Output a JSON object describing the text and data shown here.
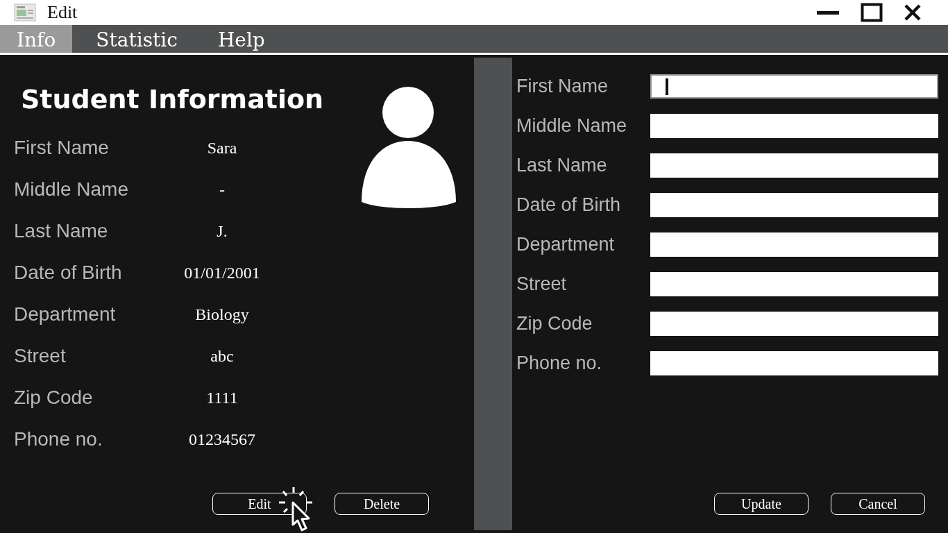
{
  "window": {
    "title": "Edit"
  },
  "tabs": [
    {
      "label": "Info",
      "selected": true
    },
    {
      "label": "Statistic",
      "selected": false
    },
    {
      "label": "Help",
      "selected": false
    }
  ],
  "student": {
    "heading": "Student Information",
    "fields": [
      {
        "label": "First Name",
        "value": "Sara"
      },
      {
        "label": "Middle Name",
        "value": "-"
      },
      {
        "label": "Last Name",
        "value": "J."
      },
      {
        "label": "Date of Birth",
        "value": "01/01/2001"
      },
      {
        "label": "Department",
        "value": "Biology"
      },
      {
        "label": "Street",
        "value": "abc"
      },
      {
        "label": "Zip Code",
        "value": "1111"
      },
      {
        "label": "Phone no.",
        "value": "01234567"
      }
    ],
    "buttons": [
      "Edit",
      "Delete"
    ]
  },
  "edit_form": {
    "fields": [
      {
        "label": "First Name",
        "focused": true
      },
      {
        "label": "Middle Name",
        "focused": false
      },
      {
        "label": "Last Name",
        "focused": false
      },
      {
        "label": "Date of Birth",
        "focused": false
      },
      {
        "label": "Department",
        "focused": false
      },
      {
        "label": "Street",
        "focused": false
      },
      {
        "label": "Zip Code",
        "focused": false
      },
      {
        "label": "Phone no.",
        "focused": false
      }
    ],
    "buttons": [
      "Update",
      "Cancel"
    ]
  }
}
